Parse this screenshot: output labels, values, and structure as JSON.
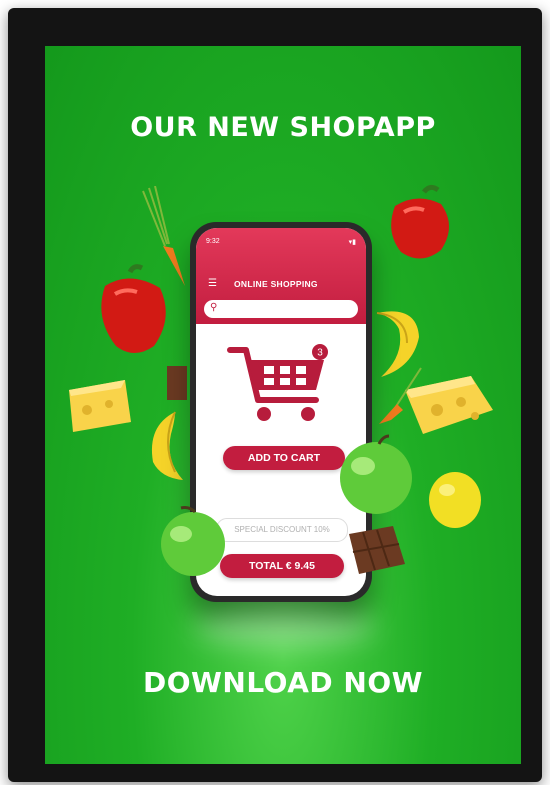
{
  "poster": {
    "title": "OUR NEW SHOPAPP",
    "cta": "DOWNLOAD NOW"
  },
  "phone": {
    "time": "9:32",
    "app_title": "ONLINE SHOPPING",
    "cart_count": "3",
    "add_to_cart_label": "ADD TO CART",
    "discount_text": "SPECIAL DISCOUNT 10%",
    "total_label": "TOTAL € 9.45"
  },
  "colors": {
    "background_green": "#1fae25",
    "accent_red": "#c21d3f"
  },
  "icons": [
    "menu-icon",
    "search-icon",
    "shopping-cart-icon",
    "signal-icon",
    "battery-icon"
  ]
}
